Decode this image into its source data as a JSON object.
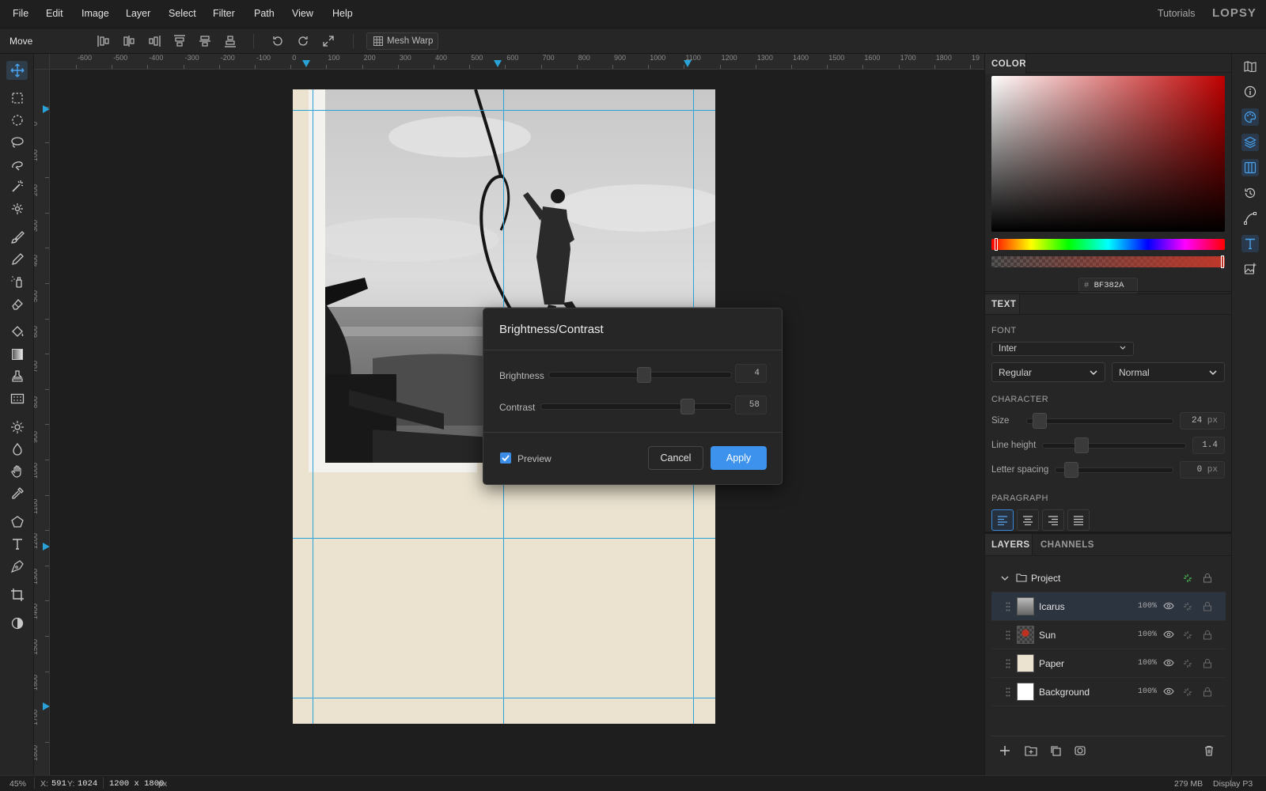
{
  "menubar": {
    "items": [
      "File",
      "Edit",
      "Image",
      "Layer",
      "Select",
      "Filter",
      "Path",
      "View",
      "Help"
    ],
    "tutorials": "Tutorials",
    "logo": "LOPSY"
  },
  "options_bar": {
    "tool_name": "Move",
    "mesh_warp_label": "Mesh Warp"
  },
  "rulers": {
    "horizontal": [
      "-600",
      "-500",
      "-400",
      "-300",
      "-200",
      "-100",
      "0",
      "100",
      "200",
      "300",
      "400",
      "500",
      "600",
      "700",
      "800",
      "900",
      "1000",
      "1100",
      "1200",
      "1300",
      "1400",
      "1500",
      "1600",
      "1700",
      "1800",
      "19"
    ],
    "vertical": [
      "0",
      "100",
      "200",
      "300",
      "400",
      "500",
      "600",
      "700",
      "800",
      "900",
      "1000",
      "1100",
      "1200",
      "1300",
      "1400",
      "1500",
      "1600",
      "1700",
      "1800"
    ]
  },
  "dialog": {
    "title": "Brightness/Contrast",
    "brightness_label": "Brightness",
    "brightness_value": "4",
    "brightness_level": 0.52,
    "contrast_label": "Contrast",
    "contrast_value": "58",
    "contrast_level": 0.77,
    "preview_label": "Preview",
    "preview_checked": true,
    "cancel_label": "Cancel",
    "apply_label": "Apply"
  },
  "color_panel": {
    "tab": "COLOR",
    "hex_prefix": "#",
    "hex_value": "BF382A",
    "accent": "#bf382a"
  },
  "text_panel": {
    "tab": "TEXT",
    "font_label": "FONT",
    "font_family": "Inter",
    "font_weight": "Regular",
    "font_style": "Normal",
    "character_label": "CHARACTER",
    "size_label": "Size",
    "size_value": "24",
    "size_unit": "px",
    "line_height_label": "Line height",
    "line_height_value": "1.4",
    "letter_spacing_label": "Letter spacing",
    "letter_spacing_value": "0",
    "letter_spacing_unit": "px",
    "paragraph_label": "PARAGRAPH"
  },
  "layers_panel": {
    "tab_layers": "LAYERS",
    "tab_channels": "CHANNELS",
    "group_name": "Project",
    "layers": [
      {
        "name": "Icarus",
        "opacity": "100%"
      },
      {
        "name": "Sun",
        "opacity": "100%"
      },
      {
        "name": "Paper",
        "opacity": "100%"
      },
      {
        "name": "Background",
        "opacity": "100%"
      }
    ]
  },
  "status_bar": {
    "zoom": "45%",
    "coords_label": "X:",
    "x_value": "591",
    "y_label": "Y:",
    "y_value": "1024",
    "doc_size": "1200 x 1800",
    "doc_unit": "px",
    "memory": "279 MB",
    "display": "Display P3"
  }
}
